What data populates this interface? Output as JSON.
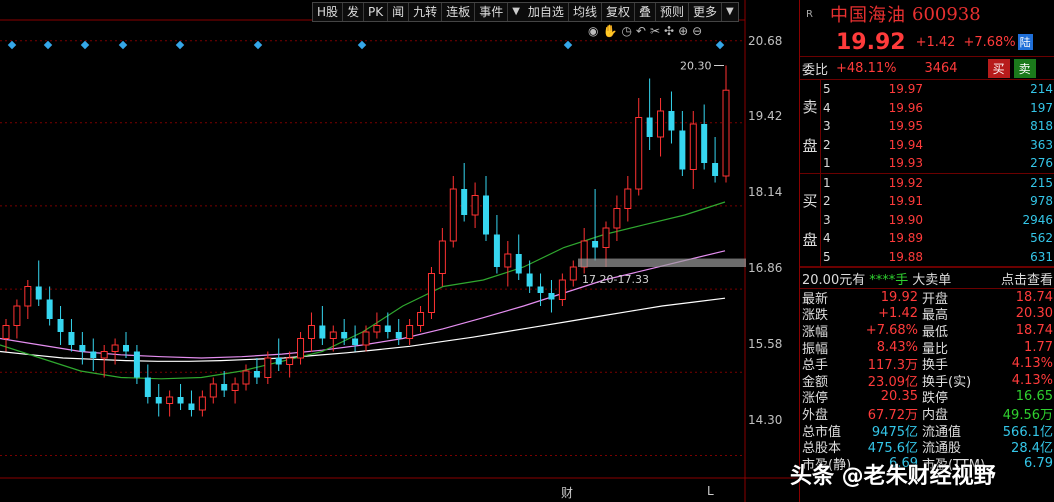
{
  "toolbar": [
    "H股",
    "发",
    "PK",
    "闻",
    "九转",
    "连板",
    "事件",
    "加自选",
    "均线",
    "复权",
    "叠",
    "预则",
    "更多"
  ],
  "chart_data": {
    "type": "candlestick",
    "ylim": [
      14.0,
      21.0
    ],
    "price_ticks": [
      "20.68",
      "19.42",
      "18.14",
      "16.86",
      "15.58",
      "14.30"
    ],
    "tick_values": [
      20.68,
      19.42,
      18.14,
      16.86,
      15.58,
      14.3
    ],
    "annotation_high": "20.30",
    "annotation_range": "17.20-17.33",
    "candles": [
      [
        16.1,
        16.4,
        15.9,
        16.3
      ],
      [
        16.3,
        16.7,
        16.1,
        16.6
      ],
      [
        16.6,
        17.0,
        16.4,
        16.9
      ],
      [
        16.9,
        17.3,
        16.6,
        16.7
      ],
      [
        16.7,
        16.9,
        16.3,
        16.4
      ],
      [
        16.4,
        16.6,
        16.0,
        16.2
      ],
      [
        16.2,
        16.4,
        15.9,
        16.0
      ],
      [
        16.0,
        16.2,
        15.7,
        15.9
      ],
      [
        15.9,
        16.1,
        15.6,
        15.8
      ],
      [
        15.8,
        16.0,
        15.5,
        15.9
      ],
      [
        15.9,
        16.1,
        15.7,
        16.0
      ],
      [
        16.0,
        16.2,
        15.8,
        15.9
      ],
      [
        15.9,
        16.0,
        15.4,
        15.5
      ],
      [
        15.5,
        15.7,
        15.1,
        15.2
      ],
      [
        15.2,
        15.4,
        14.9,
        15.1
      ],
      [
        15.1,
        15.3,
        14.9,
        15.2
      ],
      [
        15.2,
        15.4,
        15.0,
        15.1
      ],
      [
        15.1,
        15.3,
        14.9,
        15.0
      ],
      [
        15.0,
        15.3,
        14.9,
        15.2
      ],
      [
        15.2,
        15.5,
        15.1,
        15.4
      ],
      [
        15.4,
        15.6,
        15.2,
        15.3
      ],
      [
        15.3,
        15.5,
        15.1,
        15.4
      ],
      [
        15.4,
        15.7,
        15.3,
        15.6
      ],
      [
        15.6,
        15.8,
        15.4,
        15.5
      ],
      [
        15.5,
        15.9,
        15.4,
        15.8
      ],
      [
        15.8,
        16.1,
        15.6,
        15.7
      ],
      [
        15.7,
        15.9,
        15.5,
        15.8
      ],
      [
        15.8,
        16.2,
        15.7,
        16.1
      ],
      [
        16.1,
        16.5,
        15.9,
        16.3
      ],
      [
        16.3,
        16.6,
        16.0,
        16.1
      ],
      [
        16.1,
        16.3,
        15.9,
        16.2
      ],
      [
        16.2,
        16.4,
        16.0,
        16.1
      ],
      [
        16.1,
        16.3,
        15.9,
        16.0
      ],
      [
        16.0,
        16.3,
        15.9,
        16.2
      ],
      [
        16.2,
        16.5,
        16.1,
        16.3
      ],
      [
        16.3,
        16.5,
        16.1,
        16.2
      ],
      [
        16.2,
        16.4,
        16.0,
        16.1
      ],
      [
        16.1,
        16.4,
        16.0,
        16.3
      ],
      [
        16.3,
        16.6,
        16.2,
        16.5
      ],
      [
        16.5,
        17.2,
        16.4,
        17.1
      ],
      [
        17.1,
        17.8,
        16.9,
        17.6
      ],
      [
        17.6,
        18.6,
        17.5,
        18.4
      ],
      [
        18.4,
        18.8,
        17.9,
        18.0
      ],
      [
        18.0,
        18.5,
        17.8,
        18.3
      ],
      [
        18.3,
        18.6,
        17.6,
        17.7
      ],
      [
        17.7,
        18.0,
        17.1,
        17.2
      ],
      [
        17.2,
        17.6,
        16.9,
        17.4
      ],
      [
        17.4,
        17.7,
        17.0,
        17.1
      ],
      [
        17.1,
        17.3,
        16.8,
        16.9
      ],
      [
        16.9,
        17.1,
        16.6,
        16.8
      ],
      [
        16.8,
        17.0,
        16.5,
        16.7
      ],
      [
        16.7,
        17.1,
        16.6,
        17.0
      ],
      [
        17.0,
        17.3,
        16.9,
        17.2
      ],
      [
        17.2,
        17.8,
        17.1,
        17.6
      ],
      [
        17.6,
        18.4,
        17.3,
        17.5
      ],
      [
        17.5,
        17.9,
        17.2,
        17.8
      ],
      [
        17.8,
        18.3,
        17.6,
        18.1
      ],
      [
        18.1,
        18.6,
        17.9,
        18.4
      ],
      [
        18.4,
        19.8,
        18.3,
        19.5
      ],
      [
        19.5,
        20.1,
        19.0,
        19.2
      ],
      [
        19.2,
        19.8,
        18.9,
        19.6
      ],
      [
        19.6,
        19.9,
        19.1,
        19.3
      ],
      [
        19.3,
        19.6,
        18.6,
        18.7
      ],
      [
        18.7,
        19.6,
        18.4,
        19.4
      ],
      [
        19.4,
        19.7,
        18.7,
        18.8
      ],
      [
        18.8,
        19.2,
        18.5,
        18.6
      ],
      [
        18.6,
        20.3,
        18.5,
        19.92
      ]
    ],
    "ma_lines": [
      {
        "color": "#ffffff",
        "values": [
          15.9,
          15.85,
          15.8,
          15.78,
          15.76,
          15.75,
          15.75,
          15.76,
          15.78,
          15.8,
          15.84,
          15.88,
          15.93,
          15.98,
          16.05,
          16.12,
          16.2,
          16.28,
          16.36,
          16.44,
          16.52,
          16.6,
          16.66,
          16.72
        ]
      },
      {
        "color": "#e58ef0",
        "values": [
          16.1,
          16.0,
          15.9,
          15.85,
          15.82,
          15.8,
          15.82,
          15.86,
          15.92,
          16.0,
          16.1,
          16.25,
          16.42,
          16.6,
          16.8,
          17.0,
          17.15,
          17.3,
          17.45
        ]
      },
      {
        "color": "#2fa82f",
        "values": [
          16.0,
          15.8,
          15.6,
          15.5,
          15.48,
          15.5,
          15.6,
          15.75,
          15.9,
          16.2,
          16.6,
          16.9,
          17.0,
          17.2,
          17.5,
          17.7,
          17.85,
          18.0,
          18.2
        ]
      }
    ]
  },
  "bottom_markers": [
    "财",
    "L"
  ],
  "quote": {
    "r": "R",
    "name": "中国海油",
    "code": "600938",
    "price": "19.92",
    "change": "+1.42",
    "change_pct": "+7.68%",
    "badge": "陆",
    "weibi_label": "委比",
    "weibi_val": "+48.11%",
    "weicha_val": "3464",
    "buy_btn": "买",
    "sell_btn": "卖",
    "sell_label": [
      "卖",
      "盘"
    ],
    "buy_label": [
      "买",
      "盘"
    ],
    "asks": [
      {
        "lvl": "5",
        "price": "19.97",
        "vol": "214"
      },
      {
        "lvl": "4",
        "price": "19.96",
        "vol": "197"
      },
      {
        "lvl": "3",
        "price": "19.95",
        "vol": "818"
      },
      {
        "lvl": "2",
        "price": "19.94",
        "vol": "363"
      },
      {
        "lvl": "1",
        "price": "19.93",
        "vol": "276"
      }
    ],
    "bids": [
      {
        "lvl": "1",
        "price": "19.92",
        "vol": "215"
      },
      {
        "lvl": "2",
        "price": "19.91",
        "vol": "978"
      },
      {
        "lvl": "3",
        "price": "19.90",
        "vol": "2946"
      },
      {
        "lvl": "4",
        "price": "19.89",
        "vol": "562"
      },
      {
        "lvl": "5",
        "price": "19.88",
        "vol": "631"
      }
    ],
    "tick_price": "20.00元有",
    "tick_stars": "****手",
    "big_sell": "大卖单",
    "click_view": "点击查看",
    "stats": [
      {
        "l1": "最新",
        "v1": "19.92",
        "l2": "开盘",
        "v2": "18.74"
      },
      {
        "l1": "涨跌",
        "v1": "+1.42",
        "l2": "最高",
        "v2": "20.30"
      },
      {
        "l1": "涨幅",
        "v1": "+7.68%",
        "l2": "最低",
        "v2": "18.74"
      },
      {
        "l1": "振幅",
        "v1": "8.43%",
        "l2": "量比",
        "v2": "1.77"
      },
      {
        "l1": "总手",
        "v1": "117.3万",
        "l2": "换手",
        "v2": "4.13%"
      },
      {
        "l1": "金额",
        "v1": "23.09亿",
        "l2": "换手(实)",
        "v2": "4.13%"
      },
      {
        "l1": "涨停",
        "v1": "20.35",
        "l2": "跌停",
        "v2": "16.65"
      },
      {
        "l1": "外盘",
        "v1": "67.72万",
        "l2": "内盘",
        "v2": "49.56万"
      },
      {
        "l1": "总市值",
        "v1": "9475亿",
        "l2": "流通值",
        "v2": "566.1亿"
      },
      {
        "l1": "总股本",
        "v1": "475.6亿",
        "l2": "流通股",
        "v2": "28.4亿"
      },
      {
        "l1": "市盈(静)",
        "v1": "6.69",
        "l2": "市盈(TTM)",
        "v2": "6.79"
      }
    ]
  },
  "watermark": "头条 @老朱财经视野"
}
